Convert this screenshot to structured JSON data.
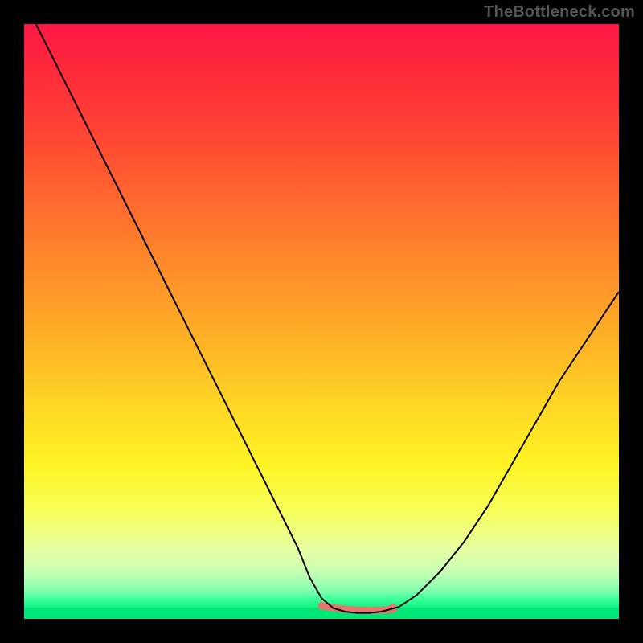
{
  "watermark": "TheBottleneck.com",
  "colors": {
    "background": "#000000",
    "curve": "#000000",
    "highlight": "#e8766d",
    "bottom_bar": "#00e676"
  },
  "chart_data": {
    "type": "line",
    "title": "",
    "xlabel": "",
    "ylabel": "",
    "xlim": [
      0,
      100
    ],
    "ylim": [
      0,
      100
    ],
    "grid": false,
    "legend": false,
    "series": [
      {
        "name": "curve",
        "color": "#000000",
        "x": [
          2,
          6,
          10,
          14,
          18,
          22,
          26,
          30,
          34,
          38,
          42,
          46,
          48,
          50,
          52,
          54,
          56,
          58,
          60,
          63,
          66,
          70,
          74,
          78,
          82,
          86,
          90,
          94,
          98,
          100
        ],
        "y": [
          100,
          92,
          84,
          76,
          68,
          60,
          52,
          44,
          36,
          28,
          20,
          12,
          7,
          3.5,
          1.8,
          1.2,
          1.0,
          1.0,
          1.2,
          2.0,
          4.0,
          8,
          13,
          19,
          26,
          33,
          40,
          46,
          52,
          55
        ]
      }
    ],
    "highlight": {
      "name": "minimum-band",
      "color": "#e8766d",
      "x_range": [
        50,
        62
      ],
      "y": 1.0,
      "end_dot": {
        "x": 62,
        "y": 1.8
      }
    },
    "gradient_stops": [
      {
        "pos": 0.0,
        "color": "#ff1744"
      },
      {
        "pos": 0.3,
        "color": "#ff6a2e"
      },
      {
        "pos": 0.54,
        "color": "#ffb426"
      },
      {
        "pos": 0.74,
        "color": "#fff324"
      },
      {
        "pos": 0.88,
        "color": "#e8ffa0"
      },
      {
        "pos": 0.97,
        "color": "#2eff95"
      },
      {
        "pos": 1.0,
        "color": "#00e676"
      }
    ]
  }
}
